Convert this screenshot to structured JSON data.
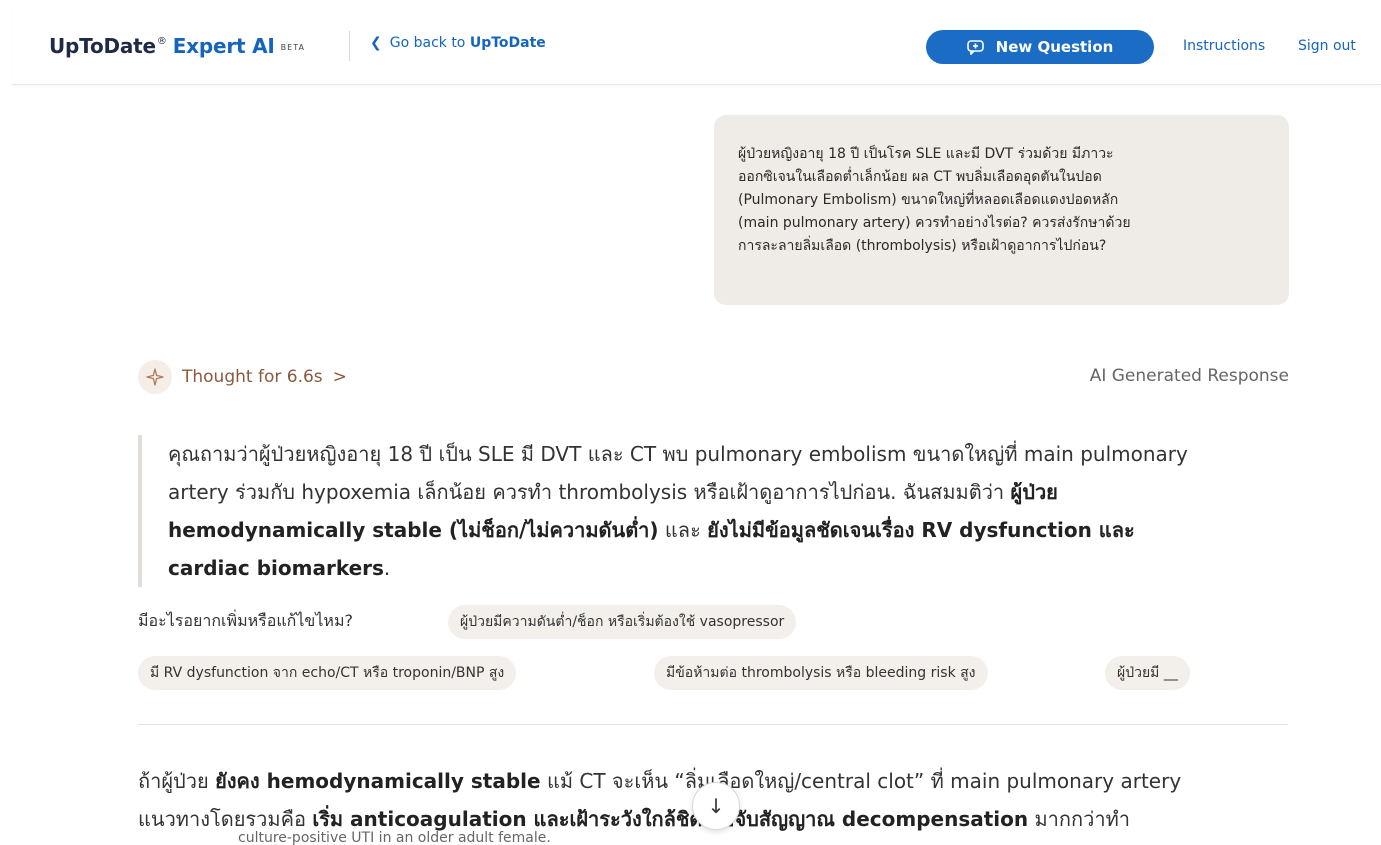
{
  "header": {
    "brand_name": "UpToDate",
    "brand_reg": "®",
    "brand_product": "Expert AI",
    "beta_tag": "BETA",
    "go_back_prefix": "Go back to",
    "go_back_target": "UpToDate",
    "new_question_label": "New Question",
    "instructions_label": "Instructions",
    "sign_out_label": "Sign out"
  },
  "user_message": {
    "lines": [
      "ผู้ป่วยหญิงอายุ 18 ปี เป็นโรค SLE และมี DVT ร่วมด้วย มีภาวะ",
      "ออกซิเจนในเลือดต่ำเล็กน้อย ผล CT พบลิ่มเลือดอุดตันในปอด",
      "(Pulmonary Embolism) ขนาดใหญ่ที่หลอดเลือดแดงปอดหลัก",
      "(main pulmonary artery) ควรทำอย่างไรต่อ? ควรส่งรักษาด้วย",
      "การละลายลิ่มเลือด (thrombolysis) หรือเฝ้าดูอาการไปก่อน?"
    ]
  },
  "response": {
    "thought_label": "Thought for 6.6s",
    "ai_generated_label": "AI Generated Response",
    "summary": {
      "line1": "คุณถามว่าผู้ป่วยหญิงอายุ 18 ปี เป็น SLE มี DVT และ CT พบ pulmonary embolism ขนาดใหญ่ที่ main pulmonary",
      "line2_plain": "artery ร่วมกับ hypoxemia เล็กน้อย ควรทำ thrombolysis หรือเฝ้าดูอาการไปก่อน. ฉันสมมติว่า ",
      "line2_bold": "ผู้ป่วย",
      "line3_bold1": "hemodynamically stable (ไม่ช็อก/ไม่ความดันต่ำ)",
      "line3_plain": " และ ",
      "line3_bold2": "ยังไม่มีข้อมูลชัดเจนเรื่อง RV dysfunction และ",
      "line4_bold": "cardiac biomarkers",
      "line4_plain": "."
    },
    "suggestions_label": "มีอะไรอยากเพิ่มหรือแก้ไขไหม?",
    "chips": [
      "ผู้ป่วยมีความดันต่ำ/ช็อก หรือเริ่มต้องใช้ vasopressor",
      "มี RV dysfunction จาก echo/CT หรือ troponin/BNP สูง",
      "มีข้อห้ามต่อ thrombolysis หรือ bleeding risk สูง",
      "ผู้ป่วยมี __"
    ],
    "answer": {
      "l1_a": "ถ้าผู้ป่วย ",
      "l1_b": "ยังคง hemodynamically stable",
      "l1_c": " แม้ CT จะเห็น “ลิ่มเลือดใหญ่/central clot” ที่ main pulmonary artery",
      "l2_a": "แนวทางโดยรวมคือ ",
      "l2_b": "เริ่ม anticoagulation และเฝ้าระวังใกล้ชิดเพื่อจับสัญญาณ decompensation",
      "l2_c": " มากกว่าทำ"
    },
    "ghost_line": "culture-positive UTI in an older adult female."
  },
  "colors": {
    "brand_blue": "#1565c0",
    "button_blue": "#1a6cc4",
    "bubble_bg": "#efebe6",
    "thought_brown": "#8b5a3c"
  }
}
